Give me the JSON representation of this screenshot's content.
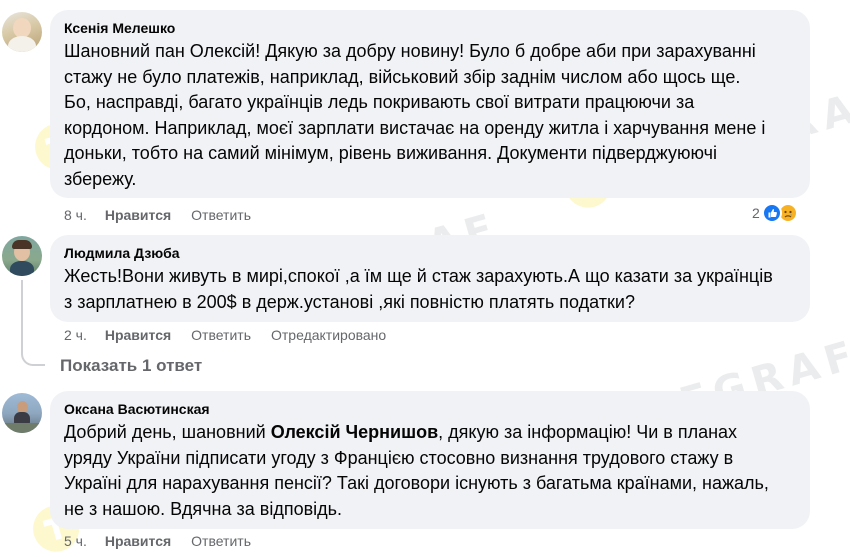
{
  "comments": [
    {
      "author": "Ксенія Мелешко",
      "text": "Шановний пан Олексій! Дякую за добру новину! Було б добре аби при зарахуванні\nстажу не було платежів, наприклад, військовий збір заднім числом або щось ще.\nБо, насправді, багато українців ледь покривають свої витрати працюючи за\nкордоном. Наприклад, моєї зарплати вистачає на оренду житла і харчування мене і\nдоньки, тобто на самий мінімум, рівень виживання. Документи підверджуюючі\nзбережу.",
      "time": "8 ч.",
      "like": "Нравится",
      "reply": "Ответить",
      "reaction_count": "2"
    },
    {
      "author": "Людмила Дзюба",
      "text": "Жесть!Вони живуть в мирі,спокої ,а їм ще й стаж зарахують.А що казати за українців\nз зарплатнею в 200$ в держ.установі ,які повністю платять податки?",
      "time": "2 ч.",
      "like": "Нравится",
      "reply": "Ответить",
      "edited": "Отредактировано"
    },
    {
      "author": "Оксана Васютинская",
      "text_before": "Добрий день, шановний ",
      "mention": "Олексій Чернишов",
      "text_after": ", дякую за інформацію! Чи в планах\nуряду України підписати угоду з Францією стосовно визнання трудового стажу в\nУкраїні для нарахування пенсії? Такі договори існують з багатьма країнами, нажаль,\nне з нашою. Вдячна за відповідь.",
      "time": "5 ч.",
      "like": "Нравится",
      "reply": "Ответить"
    }
  ],
  "show_replies": "Показать 1 ответ",
  "watermark": "TELEGRAF",
  "colors": {
    "bubble": "#f0f2f5",
    "secondary_text": "#65676b",
    "like_reaction": "#1877f2",
    "sad_reaction": "#f7b125",
    "watermark_logo": "#f5e33a"
  }
}
